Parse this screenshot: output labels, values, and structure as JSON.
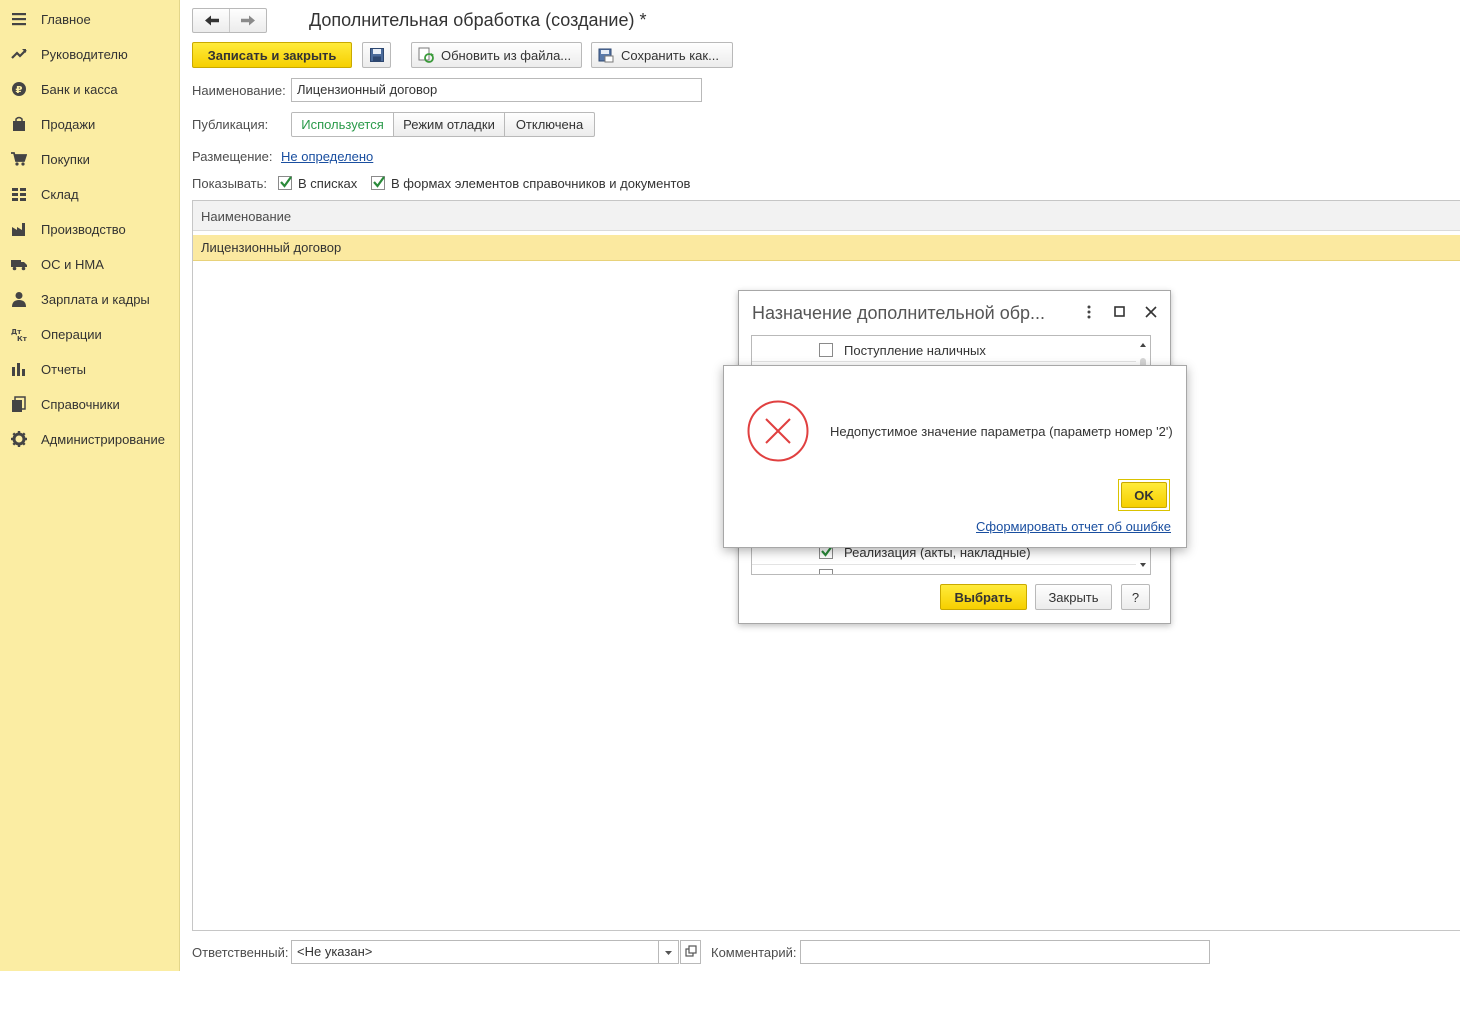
{
  "sidebar": {
    "items": [
      {
        "label": "Главное",
        "icon": "menu-icon"
      },
      {
        "label": "Руководителю",
        "icon": "trend-icon"
      },
      {
        "label": "Банк и касса",
        "icon": "ruble-icon"
      },
      {
        "label": "Продажи",
        "icon": "bag-icon"
      },
      {
        "label": "Покупки",
        "icon": "cart-icon"
      },
      {
        "label": "Склад",
        "icon": "warehouse-icon"
      },
      {
        "label": "Производство",
        "icon": "factory-icon"
      },
      {
        "label": "ОС и НМА",
        "icon": "truck-icon"
      },
      {
        "label": "Зарплата и кадры",
        "icon": "person-icon"
      },
      {
        "label": "Операции",
        "icon": "dt-kt-icon"
      },
      {
        "label": "Отчеты",
        "icon": "bar-chart-icon"
      },
      {
        "label": "Справочники",
        "icon": "books-icon"
      },
      {
        "label": "Администрирование",
        "icon": "gear-icon"
      }
    ]
  },
  "form": {
    "title": "Дополнительная обработка (создание) *",
    "toolbar": {
      "save_close": "Записать и закрыть",
      "update_from_file": "Обновить из файла...",
      "save_as": "Сохранить как..."
    },
    "name_label": "Наименование:",
    "name_value": "Лицензионный договор",
    "publication_label": "Публикация:",
    "publication_options": [
      "Используется",
      "Режим отладки",
      "Отключена"
    ],
    "publication_selected": "Используется",
    "placement_label": "Размещение:",
    "placement_value": "Не определено",
    "show_label": "Показывать:",
    "show_in_lists": "В списках",
    "show_in_forms": "В формах элементов справочников и документов",
    "show_in_lists_checked": true,
    "show_in_forms_checked": true,
    "table": {
      "header": "Наименование",
      "rows": [
        "Лицензионный договор"
      ]
    },
    "responsible_label": "Ответственный:",
    "responsible_value": "<Не указан>",
    "comment_label": "Комментарий:",
    "comment_value": ""
  },
  "dialog": {
    "title": "Назначение дополнительной обр...",
    "items": [
      {
        "label": "Поступление наличных",
        "checked": false
      },
      {
        "label": "Реализация (акты, накладные)",
        "checked": true
      }
    ],
    "select_button": "Выбрать",
    "close_button": "Закрыть",
    "help_button": "?"
  },
  "error": {
    "message": "Недопустимое значение параметра (параметр номер '2')",
    "ok_button": "OK",
    "report_link": "Сформировать отчет об ошибке"
  },
  "colors": {
    "sidebar_bg": "#fbeda3",
    "accent_yellow": "#f6cf00",
    "selected_row": "#fbe9a0",
    "link": "#1a4fa0",
    "error_red": "#e04040",
    "active_green": "#2a9a4a"
  }
}
